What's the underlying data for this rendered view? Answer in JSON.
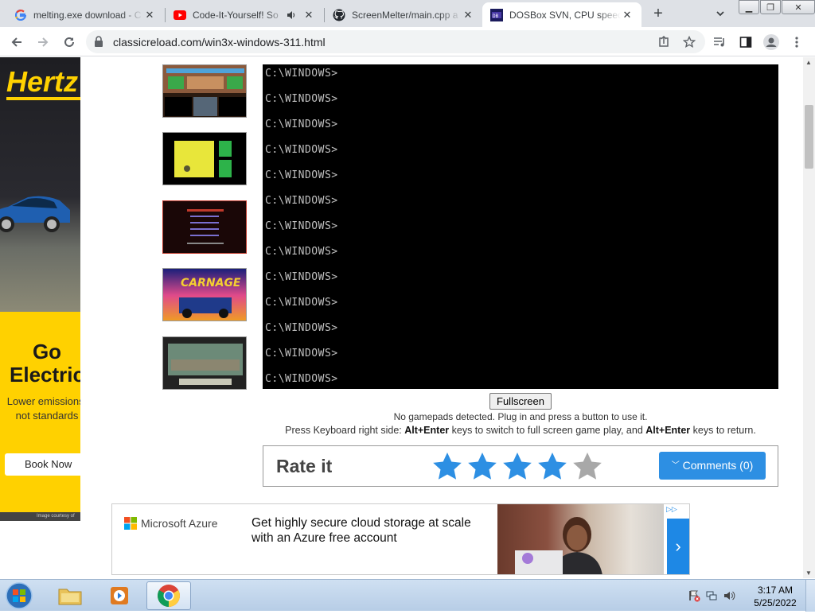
{
  "browser": {
    "tabs": [
      {
        "label": "melting.exe download - C",
        "icon": "google-icon"
      },
      {
        "label": "Code-It-Yourself! So",
        "icon": "youtube-icon"
      },
      {
        "label": "ScreenMelter/main.cpp a",
        "icon": "github-icon"
      },
      {
        "label": "DOSBox SVN, CPU speed",
        "icon": "dosbox-icon"
      }
    ],
    "active_tab": 3,
    "url": "classicreload.com/win3x-windows-311.html"
  },
  "side_ad": {
    "brand": "Hertz",
    "headline": "Go Electric",
    "subtext": "Lower emissions, not standards",
    "cta": "Book Now",
    "credit": "Image courtesy of",
    "accent": "#ffd100"
  },
  "emulator": {
    "lines": [
      "C:\\WINDOWS>",
      "C:\\WINDOWS>",
      "C:\\WINDOWS>",
      "C:\\WINDOWS>",
      "C:\\WINDOWS>",
      "C:\\WINDOWS>",
      "C:\\WINDOWS>",
      "C:\\WINDOWS>",
      "C:\\WINDOWS>",
      "C:\\WINDOWS>",
      "C:\\WINDOWS>",
      "C:\\WINDOWS>",
      "C:\\WINDOWS>"
    ],
    "fullscreen_label": "Fullscreen",
    "gamepad_note": "No gamepads detected. Plug in and press a button to use it.",
    "kb_prefix": "Press Keyboard right side: ",
    "kb_key1": "Alt+Enter",
    "kb_middle": " keys to switch to full screen game play, and ",
    "kb_key2": "Alt+Enter",
    "kb_suffix": " keys to return."
  },
  "rating": {
    "label": "Rate it",
    "stars_filled": 4,
    "stars_total": 5,
    "comments_label": "Comments (0)",
    "star_color": "#2d8fe3",
    "star_empty_color": "#a8a8a8"
  },
  "bottom_ad": {
    "brand": "Microsoft Azure",
    "text": "Get highly secure cloud storage at scale with an Azure free account"
  },
  "taskbar": {
    "time": "3:17 AM",
    "date": "5/25/2022"
  }
}
